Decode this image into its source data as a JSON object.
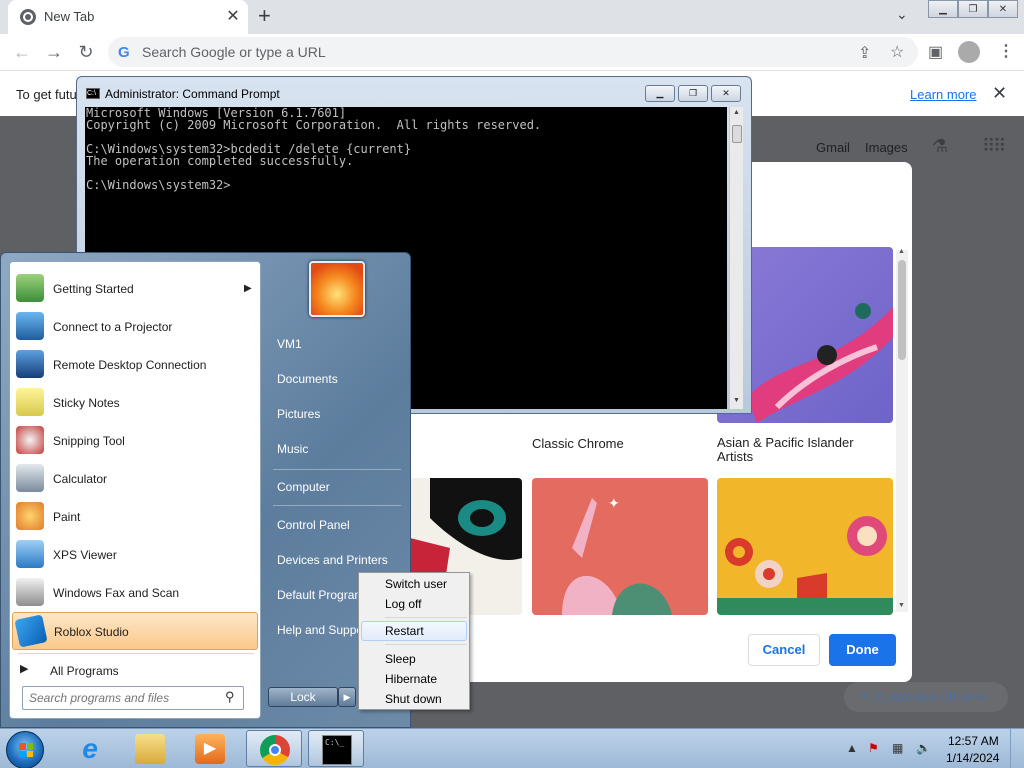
{
  "browser": {
    "tab_title": "New Tab",
    "omnibox_placeholder": "Search Google or type a URL",
    "info_bar_text": "To get futu",
    "info_bar_link": "Learn more",
    "top_links": [
      "Gmail",
      "Images"
    ],
    "customize_label": "Customize Chrome"
  },
  "dialog": {
    "themes": [
      {
        "label": "Classic Chrome"
      },
      {
        "label": "Asian & Pacific Islander Artists"
      }
    ],
    "cancel_label": "Cancel",
    "done_label": "Done"
  },
  "cmd": {
    "title": "Administrator: Command Prompt",
    "lines": [
      "Microsoft Windows [Version 6.1.7601]",
      "Copyright (c) 2009 Microsoft Corporation.  All rights reserved.",
      "",
      "C:\\Windows\\system32>bcdedit /delete {current}",
      "The operation completed successfully.",
      "",
      "C:\\Windows\\system32>"
    ]
  },
  "start_menu": {
    "programs": [
      {
        "label": "Getting Started",
        "icon": "getting-started-icon",
        "has_submenu": true
      },
      {
        "label": "Connect to a Projector",
        "icon": "projector-icon"
      },
      {
        "label": "Remote Desktop Connection",
        "icon": "remote-desktop-icon"
      },
      {
        "label": "Sticky Notes",
        "icon": "sticky-notes-icon"
      },
      {
        "label": "Snipping Tool",
        "icon": "snipping-tool-icon"
      },
      {
        "label": "Calculator",
        "icon": "calculator-icon"
      },
      {
        "label": "Paint",
        "icon": "paint-icon"
      },
      {
        "label": "XPS Viewer",
        "icon": "xps-viewer-icon"
      },
      {
        "label": "Windows Fax and Scan",
        "icon": "fax-scan-icon"
      },
      {
        "label": "Roblox Studio",
        "icon": "roblox-studio-icon",
        "selected": true
      }
    ],
    "all_programs": "All Programs",
    "search_placeholder": "Search programs and files",
    "right_items": [
      "VM1",
      "Documents",
      "Pictures",
      "Music",
      "Computer",
      "Control Panel",
      "Devices and Printers",
      "Default Programs",
      "Help and Support"
    ],
    "lock_label": "Lock"
  },
  "shutdown_menu": {
    "items": [
      "Switch user",
      "Log off",
      "Restart",
      "Sleep",
      "Hibernate",
      "Shut down"
    ],
    "hovered": "Restart"
  },
  "taskbar": {
    "apps": [
      "internet-explorer-icon",
      "windows-explorer-icon",
      "media-player-icon",
      "chrome-icon",
      "command-prompt-icon"
    ],
    "time": "12:57 AM",
    "date": "1/14/2024"
  }
}
